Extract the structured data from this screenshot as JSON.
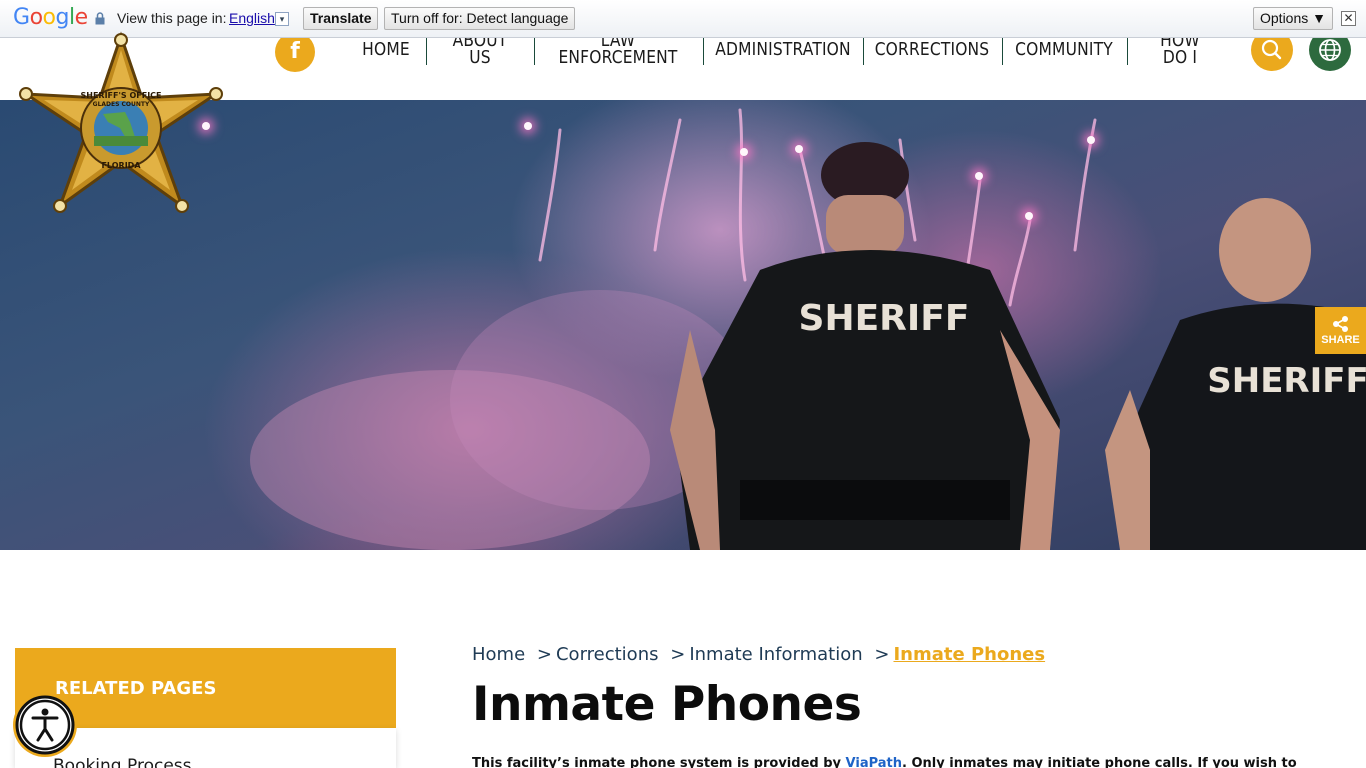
{
  "translate_bar": {
    "google_logo": [
      "G",
      "o",
      "o",
      "g",
      "l",
      "e"
    ],
    "google_colors": [
      "#4285F4",
      "#EA4335",
      "#FBBC05",
      "#4285F4",
      "#34A853",
      "#EA4335"
    ],
    "view_label": "View this page in:",
    "language": "English",
    "dropdown_glyph": "▾",
    "translate_button": "Translate",
    "turn_off_button": "Turn off for: Detect language",
    "options_button": "Options ▼",
    "close_glyph": "✕"
  },
  "header": {
    "facebook_glyph": "f",
    "nav": [
      {
        "label": "HOME"
      },
      {
        "label": "ABOUT US"
      },
      {
        "label": "LAW ENFORCEMENT"
      },
      {
        "label": "ADMINISTRATION"
      },
      {
        "label": "CORRECTIONS"
      },
      {
        "label": "COMMUNITY"
      },
      {
        "label": "HOW DO I"
      }
    ],
    "search_icon": "search-icon",
    "globe_icon": "globe-icon"
  },
  "logo": {
    "top_text": "SHERIFF'S OFFICE",
    "ring_text": "GLADES COUNTY",
    "bottom_text": "FLORIDA"
  },
  "hero": {
    "vest_text_1": "SHERIFF",
    "vest_text_2": "SHERIFF"
  },
  "share": {
    "label": "SHARE"
  },
  "sidebar": {
    "title": "RELATED PAGES",
    "items": [
      "Booking Process"
    ]
  },
  "breadcrumb": [
    "Home",
    "Corrections",
    "Inmate Information",
    "Inmate Phones"
  ],
  "breadcrumb_separator": ">",
  "page_title": "Inmate Phones",
  "intro": {
    "before": "This facility’s inmate phone system is provided by ",
    "link": "ViaPath",
    "after": ". Only inmates may initiate phone calls. If you wish to"
  },
  "colors": {
    "accent": "#eba91d",
    "green": "#2d6a3e",
    "link": "#1e63c7"
  }
}
